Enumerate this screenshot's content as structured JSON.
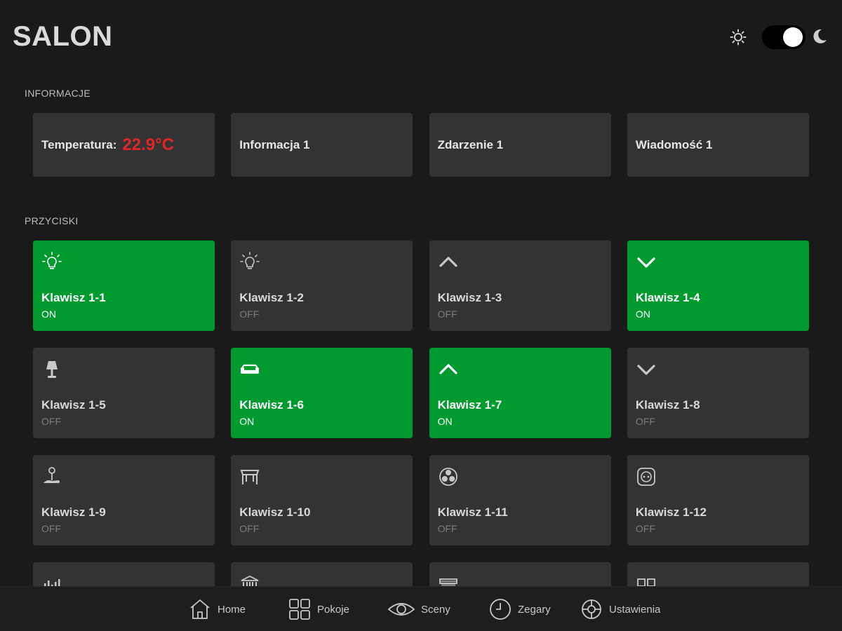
{
  "header": {
    "title": "SALON",
    "theme_toggle": {
      "mode": "dark",
      "light_icon": "sun-icon",
      "dark_icon": "moon-icon"
    }
  },
  "sections": {
    "info_label": "INFORMACJE",
    "buttons_label": "PRZYCISKI"
  },
  "info_cards": {
    "temperature": {
      "label": "Temperatura:",
      "value": "22.9°C",
      "value_color": "#e02626"
    },
    "card2": "Informacja 1",
    "card3": "Zdarzenie 1",
    "card4": "Wiadomość 1"
  },
  "buttons": [
    {
      "name": "Klawisz 1-1",
      "state": "ON",
      "icon": "lightbulb-icon"
    },
    {
      "name": "Klawisz 1-2",
      "state": "OFF",
      "icon": "lightbulb-icon"
    },
    {
      "name": "Klawisz 1-3",
      "state": "OFF",
      "icon": "chevron-up-icon"
    },
    {
      "name": "Klawisz 1-4",
      "state": "ON",
      "icon": "chevron-down-icon"
    },
    {
      "name": "Klawisz 1-5",
      "state": "OFF",
      "icon": "table-lamp-icon"
    },
    {
      "name": "Klawisz 1-6",
      "state": "ON",
      "icon": "sofa-icon"
    },
    {
      "name": "Klawisz 1-7",
      "state": "ON",
      "icon": "chevron-up-icon"
    },
    {
      "name": "Klawisz 1-8",
      "state": "OFF",
      "icon": "chevron-down-icon"
    },
    {
      "name": "Klawisz 1-9",
      "state": "OFF",
      "icon": "floor-lamp-icon"
    },
    {
      "name": "Klawisz 1-10",
      "state": "OFF",
      "icon": "awning-icon"
    },
    {
      "name": "Klawisz 1-11",
      "state": "OFF",
      "icon": "fan-icon"
    },
    {
      "name": "Klawisz 1-12",
      "state": "OFF",
      "icon": "socket-icon"
    },
    {
      "name": "",
      "state": "",
      "icon": "equalizer-icon"
    },
    {
      "name": "",
      "state": "",
      "icon": "gate-icon"
    },
    {
      "name": "",
      "state": "",
      "icon": "blind-icon"
    },
    {
      "name": "",
      "state": "",
      "icon": "window-icon"
    }
  ],
  "colors": {
    "on": "#019a2f",
    "off": "#333333",
    "background": "#1a1a1a"
  },
  "nav": {
    "home": "Home",
    "rooms": "Pokoje",
    "scenes": "Sceny",
    "clocks": "Zegary",
    "settings": "Ustawienia"
  }
}
